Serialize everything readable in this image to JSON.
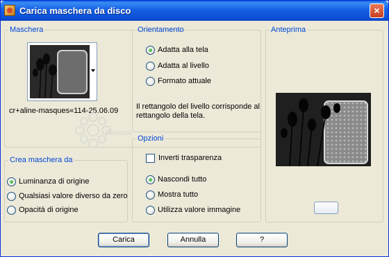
{
  "window": {
    "title": "Carica maschera da disco",
    "close_symbol": "×"
  },
  "maschera": {
    "legend": "Maschera",
    "mask_name": "cr+aline-masques«114-25.06.09"
  },
  "watermark": {
    "text": "Pinuccia"
  },
  "orientamento": {
    "legend": "Orientamento",
    "options": [
      "Adatta alla tela",
      "Adatta al livello",
      "Formato attuale"
    ],
    "selected": "Adatta alla tela",
    "description": "Il rettangolo del livello corrisponde al rettangolo della tela."
  },
  "anteprima": {
    "legend": "Anteprima"
  },
  "crea": {
    "legend": "Crea maschera da",
    "options": [
      "Luminanza di origine",
      "Qualsiasi valore diverso da zero",
      "Opacità di origine"
    ],
    "selected": "Luminanza di origine"
  },
  "opzioni": {
    "legend": "Opzioni",
    "invert_label": "Inverti trasparenza",
    "invert_checked": false,
    "options": [
      "Nascondi tutto",
      "Mostra tutto",
      "Utilizza valore immagine"
    ],
    "selected": "Nascondi tutto"
  },
  "buttons": {
    "load": "Carica",
    "cancel": "Annulla",
    "help": "?"
  },
  "icons": {
    "app": "psp-app-icon",
    "close": "close-icon",
    "dropdown": "chevron-down-icon"
  },
  "colors": {
    "titlebar": "#0b4fd6",
    "group_legend": "#0046d5",
    "dialog_bg": "#ece9d8"
  }
}
